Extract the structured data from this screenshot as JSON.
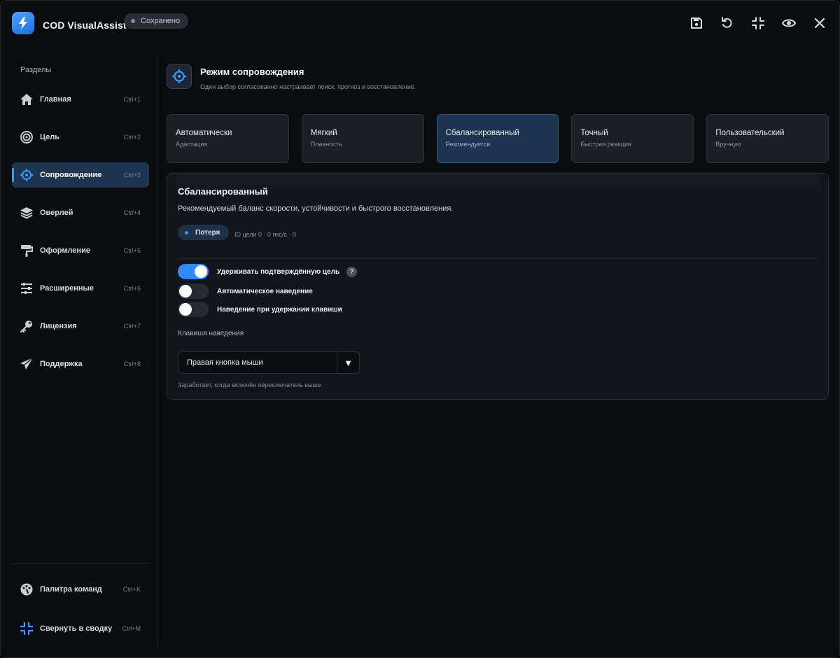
{
  "app": {
    "title": "COD VisualAssist",
    "status": "Сохранено"
  },
  "toolbar": {
    "icons": [
      "save-icon",
      "undo-icon",
      "collapse-icon",
      "eye-icon",
      "close-icon"
    ]
  },
  "sidebar": {
    "heading": "Разделы",
    "items": [
      {
        "label": "Главная",
        "shortcut": "Ctrl+1",
        "icon": "home-icon"
      },
      {
        "label": "Цель",
        "shortcut": "Ctrl+2",
        "icon": "target-icon"
      },
      {
        "label": "Сопровождение",
        "shortcut": "Ctrl+3",
        "icon": "crosshair-icon",
        "active": true
      },
      {
        "label": "Оверлей",
        "shortcut": "Ctrl+4",
        "icon": "layers-icon"
      },
      {
        "label": "Оформление",
        "shortcut": "Ctrl+5",
        "icon": "paint-roller-icon"
      },
      {
        "label": "Расширенные",
        "shortcut": "Ctrl+6",
        "icon": "sliders-icon"
      },
      {
        "label": "Лицензия",
        "shortcut": "Ctrl+7",
        "icon": "key-icon"
      },
      {
        "label": "Поддержка",
        "shortcut": "Ctrl+8",
        "icon": "paper-plane-icon"
      }
    ],
    "bottom": [
      {
        "label": "Палитра команд",
        "shortcut": "Ctrl+K",
        "icon": "palette-icon"
      },
      {
        "label": "Свернуть в сводку",
        "shortcut": "Ctrl+M",
        "icon": "compress-icon"
      }
    ]
  },
  "mode": {
    "title": "Режим сопровождения",
    "subtitle": "Один выбор согласованно настраивает поиск, прогноз и восстановление.",
    "presets": [
      {
        "name": "Автоматически",
        "desc": "Адаптация"
      },
      {
        "name": "Мягкий",
        "desc": "Плавность"
      },
      {
        "name": "Сбалансированный",
        "desc": "Рекомендуется",
        "active": true
      },
      {
        "name": "Точный",
        "desc": "Быстрая реакция"
      },
      {
        "name": "Пользовательский",
        "desc": "Вручную"
      }
    ]
  },
  "detail": {
    "title": "Сбалансированный",
    "description": "Рекомендуемый баланс скорости, устойчивости и быстрого восстановления.",
    "status": "Потеря",
    "meta": "ID цели 0 · 0 пкс/с · 0",
    "toggles": [
      {
        "label": "Удерживать подтверждённую цель",
        "on": true,
        "help": "?"
      },
      {
        "label": "Автоматическое наведение",
        "on": false
      },
      {
        "label": "Наведение при удержании клавиши",
        "on": false
      }
    ],
    "key_label": "Клавиша наведения",
    "key_value": "Правая кнопка мыши",
    "hint": "Заработает, когда включён переключатель выше."
  },
  "colors": {
    "accent": "#3b9bff",
    "active_bg": "#1e3550",
    "background": "#0b0c10"
  }
}
